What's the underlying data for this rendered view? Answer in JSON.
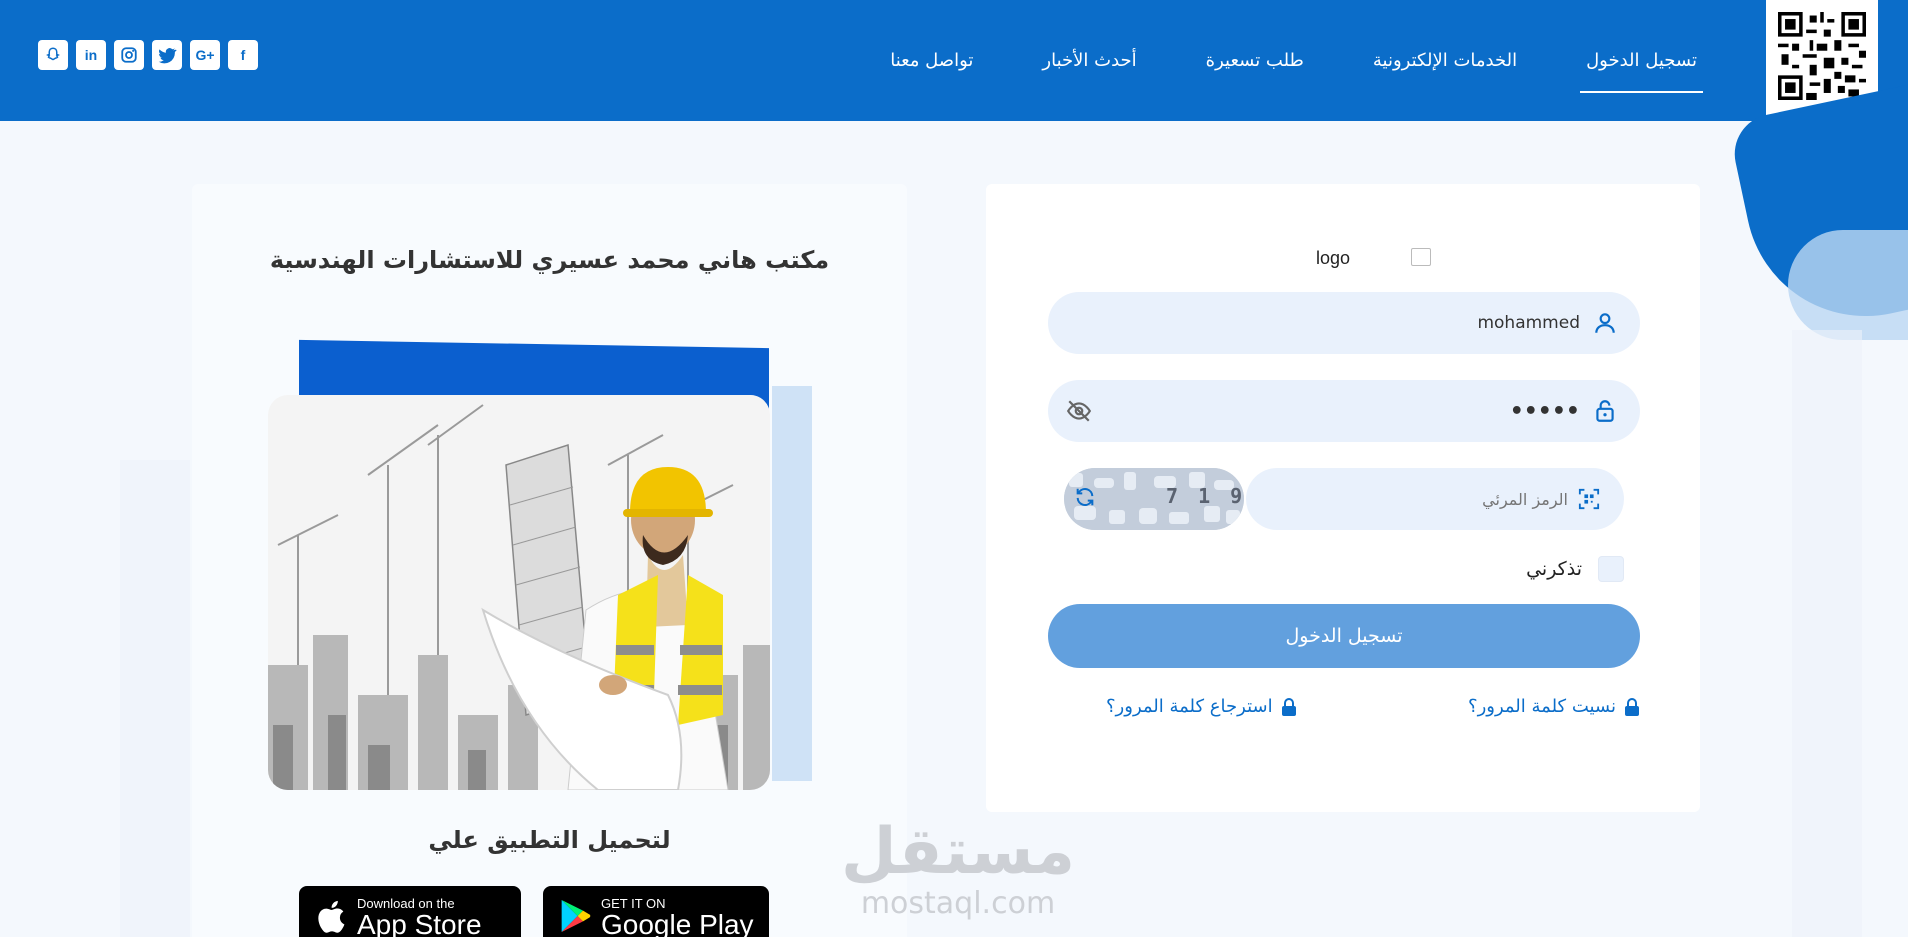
{
  "header": {
    "nav": [
      {
        "label": "تسجيل الدخول",
        "active": true
      },
      {
        "label": "الخدمات الإلكترونية"
      },
      {
        "label": "طلب تسعيرة"
      },
      {
        "label": "أحدث الأخبار"
      },
      {
        "label": "تواصل معنا"
      }
    ],
    "social": [
      {
        "name": "facebook-icon",
        "glyph": "f"
      },
      {
        "name": "google-plus-icon",
        "glyph": "G+"
      },
      {
        "name": "twitter-icon",
        "glyph": "🐦"
      },
      {
        "name": "instagram-icon",
        "glyph": "◎"
      },
      {
        "name": "linkedin-icon",
        "glyph": "in"
      },
      {
        "name": "snapchat-icon",
        "glyph": "👻"
      }
    ]
  },
  "left": {
    "company_name": "مكتب هاني محمد عسيري للاستشارات الهندسية",
    "app_title": "لتحميل التطبيق علي",
    "appstore": {
      "small": "Download on the",
      "big": "App Store"
    },
    "googleplay": {
      "small": "GET IT ON",
      "big": "Google Play"
    }
  },
  "login": {
    "logo_alt": "logo",
    "username_value": "mohammed",
    "password_value": "•••••",
    "captcha_placeholder": "الرمز المرئي",
    "captcha_code": "7 1 9 3",
    "remember_label": "تذكرني",
    "submit_label": "تسجيل الدخول",
    "forgot_label": "نسيت كلمة المرور؟",
    "recover_label": "استرجاع كلمة المرور؟"
  },
  "watermark": {
    "ar": "مستقل",
    "en": "mostaql.com"
  },
  "colors": {
    "primary": "#0b6dc9",
    "button": "#62a0de",
    "field": "#e9f1fc"
  }
}
